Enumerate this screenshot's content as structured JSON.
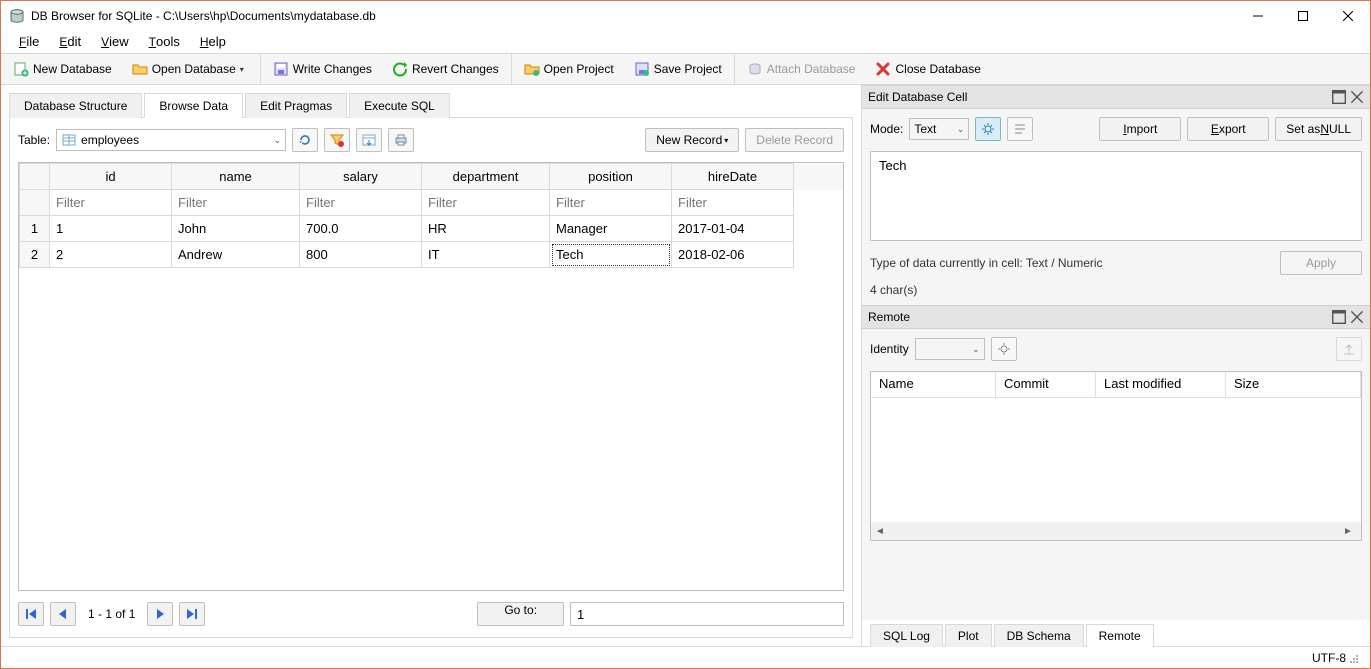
{
  "window": {
    "title": "DB Browser for SQLite - C:\\Users\\hp\\Documents\\mydatabase.db"
  },
  "menu": {
    "file": "File",
    "edit": "Edit",
    "view": "View",
    "tools": "Tools",
    "help": "Help"
  },
  "toolbar": {
    "new_db": "New Database",
    "open_db": "Open Database",
    "write_changes": "Write Changes",
    "revert_changes": "Revert Changes",
    "open_project": "Open Project",
    "save_project": "Save Project",
    "attach_db": "Attach Database",
    "close_db": "Close Database"
  },
  "tabs": {
    "structure": "Database Structure",
    "browse": "Browse Data",
    "pragmas": "Edit Pragmas",
    "execute": "Execute SQL"
  },
  "browse": {
    "table_label": "Table:",
    "table_selected": "employees",
    "new_record": "New Record",
    "delete_record": "Delete Record",
    "columns": [
      "id",
      "name",
      "salary",
      "department",
      "position",
      "hireDate"
    ],
    "filter_placeholder": "Filter",
    "rows": [
      {
        "num": "1",
        "cells": [
          "1",
          "John",
          "700.0",
          "HR",
          "Manager",
          "2017-01-04"
        ]
      },
      {
        "num": "2",
        "cells": [
          "2",
          "Andrew",
          "800",
          "IT",
          "Tech",
          "2018-02-06"
        ]
      }
    ],
    "nav_label": "1 - 1 of 1",
    "goto_label": "Go to:",
    "goto_value": "1"
  },
  "edit_cell": {
    "title": "Edit Database Cell",
    "mode_label": "Mode:",
    "mode_value": "Text",
    "import": "Import",
    "export": "Export",
    "set_null": "Set as NULL",
    "value": "Tech",
    "type_hint": "Type of data currently in cell: Text / Numeric",
    "chars": "4 char(s)",
    "apply": "Apply"
  },
  "remote": {
    "title": "Remote",
    "identity_label": "Identity",
    "cols": {
      "name": "Name",
      "commit": "Commit",
      "lastmod": "Last modified",
      "size": "Size"
    }
  },
  "bottom_tabs": {
    "sqllog": "SQL Log",
    "plot": "Plot",
    "dbschema": "DB Schema",
    "remote": "Remote"
  },
  "status": {
    "encoding": "UTF-8"
  }
}
